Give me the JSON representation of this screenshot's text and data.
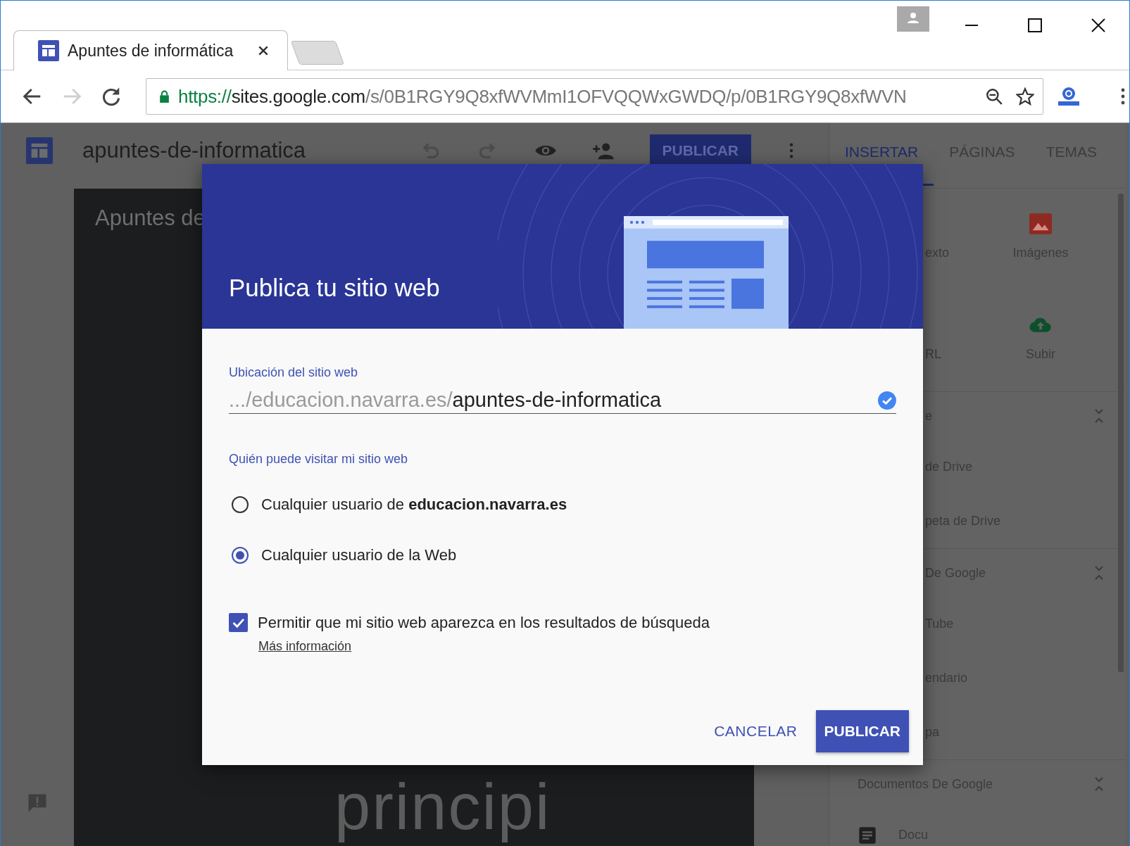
{
  "browser": {
    "tab_title": "Apuntes de informática",
    "forward_disabled": true,
    "url": {
      "scheme": "https://",
      "host": "sites.google.com",
      "path": "/s/0B1RGY9Q8xfWVMmI1OFVQQWxGWDQ/p/0B1RGY9Q8xfWVN"
    }
  },
  "app": {
    "site_title": "apuntes-de-informatica",
    "publish_button": "PUBLICAR",
    "page_heading": "Apuntes de",
    "page_text": "principi"
  },
  "panel": {
    "tabs": [
      {
        "label": "INSERTAR",
        "selected": true
      },
      {
        "label": "PÁGINAS",
        "selected": false
      },
      {
        "label": "TEMAS",
        "selected": false
      }
    ],
    "tiles": [
      {
        "kind": "text",
        "label": "exto"
      },
      {
        "kind": "image",
        "label": "Imágenes"
      },
      {
        "kind": "link",
        "label": "RL"
      },
      {
        "kind": "upload",
        "label": "Subir"
      }
    ],
    "sections": [
      {
        "title": "e",
        "items": [
          {
            "label": "de Drive"
          },
          {
            "label": "peta de Drive"
          }
        ]
      },
      {
        "title": "De Google",
        "items": [
          {
            "label": "Tube"
          },
          {
            "label": "endario"
          },
          {
            "label": "pa"
          }
        ]
      },
      {
        "title": "Documentos De Google",
        "items": [
          {
            "label": "Docu"
          }
        ]
      }
    ]
  },
  "dialog": {
    "title": "Publica tu sitio web",
    "location": {
      "label": "Ubicación del sitio web",
      "prefix": ".../educacion.navarra.es/",
      "value": "apuntes-de-informatica"
    },
    "visibility": {
      "label": "Quién puede visitar mi sitio web",
      "options": [
        {
          "label": "Cualquier usuario de **educacion.navarra.es**",
          "selected": false
        },
        {
          "label": "Cualquier usuario de la Web",
          "selected": true
        }
      ]
    },
    "search_option": {
      "label": "Permitir que mi sitio web aparezca en los resultados de búsqueda",
      "checked": true,
      "link": "Más información"
    },
    "buttons": {
      "cancel": "CANCELAR",
      "publish": "PUBLICAR"
    }
  }
}
